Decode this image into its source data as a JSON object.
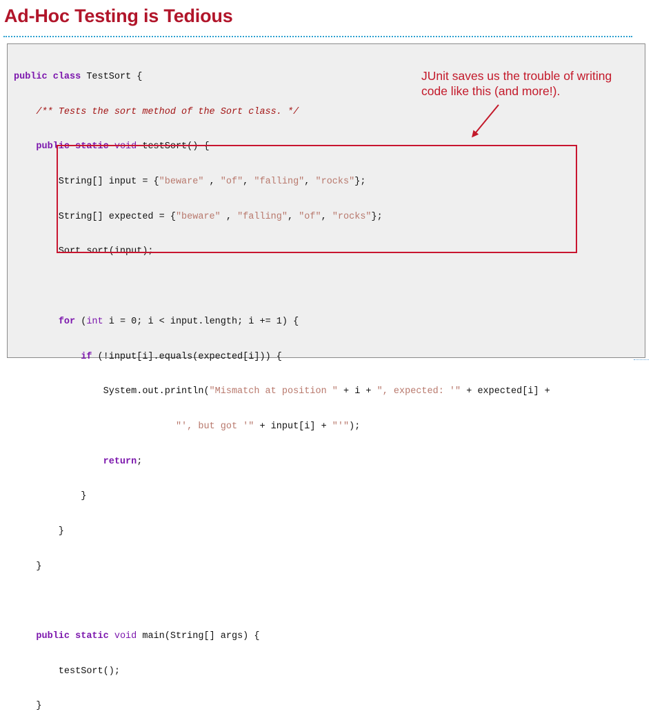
{
  "slide": {
    "title": "Ad-Hoc Testing is Tedious",
    "annotation": "JUnit saves us the trouble of writing code like this (and more!).",
    "accent_color": "#b1152a",
    "highlight_color": "#c8152f"
  },
  "code": {
    "l1": {
      "a": "public",
      "b": "class",
      "c": " TestSort {"
    },
    "l2": {
      "indent": "    ",
      "comment": "/** Tests the sort method of the Sort class. */"
    },
    "l3": {
      "indent": "    ",
      "a": "public",
      "b": "static",
      "c": "void",
      "d": " testSort() {"
    },
    "l4": {
      "a": "        String[] input = {",
      "s1": "\"beware\"",
      "b": " , ",
      "s2": "\"of\"",
      "c": ", ",
      "s3": "\"falling\"",
      "d": ", ",
      "s4": "\"rocks\"",
      "e": "};"
    },
    "l5": {
      "a": "        String[] expected = {",
      "s1": "\"beware\"",
      "b": " , ",
      "s2": "\"falling\"",
      "c": ", ",
      "s3": "\"of\"",
      "d": ", ",
      "s4": "\"rocks\"",
      "e": "};"
    },
    "l6": {
      "a": "        Sort.sort(input);"
    },
    "l7": {
      "a": ""
    },
    "l8": {
      "indent": "        ",
      "kw": "for",
      "b": " (",
      "ty": "int",
      "c": " i = 0; i < input.length; i += 1) {"
    },
    "l9": {
      "indent": "            ",
      "kw": "if",
      "b": " (!input[i].equals(expected[i])) {"
    },
    "l10": {
      "a": "                System.out.println(",
      "s1": "\"Mismatch at position \"",
      "b": " + i + ",
      "s2": "\", expected: '\"",
      "c": " + expected[i] +"
    },
    "l11": {
      "a": "                             ",
      "s1": "\"', but got '\"",
      "b": " + input[i] + ",
      "s2": "\"'\"",
      "c": ");"
    },
    "l12": {
      "indent": "                ",
      "kw": "return",
      "b": ";"
    },
    "l13": {
      "a": "            }"
    },
    "l14": {
      "a": "        }"
    },
    "l15": {
      "a": "    }"
    },
    "l16": {
      "a": ""
    },
    "l17": {
      "indent": "    ",
      "a": "public",
      "b": "static",
      "c": "void",
      "d": " main(String[] args) {"
    },
    "l18": {
      "a": "        testSort();"
    },
    "l19": {
      "a": "    }"
    },
    "l20": {
      "a": "}"
    }
  }
}
